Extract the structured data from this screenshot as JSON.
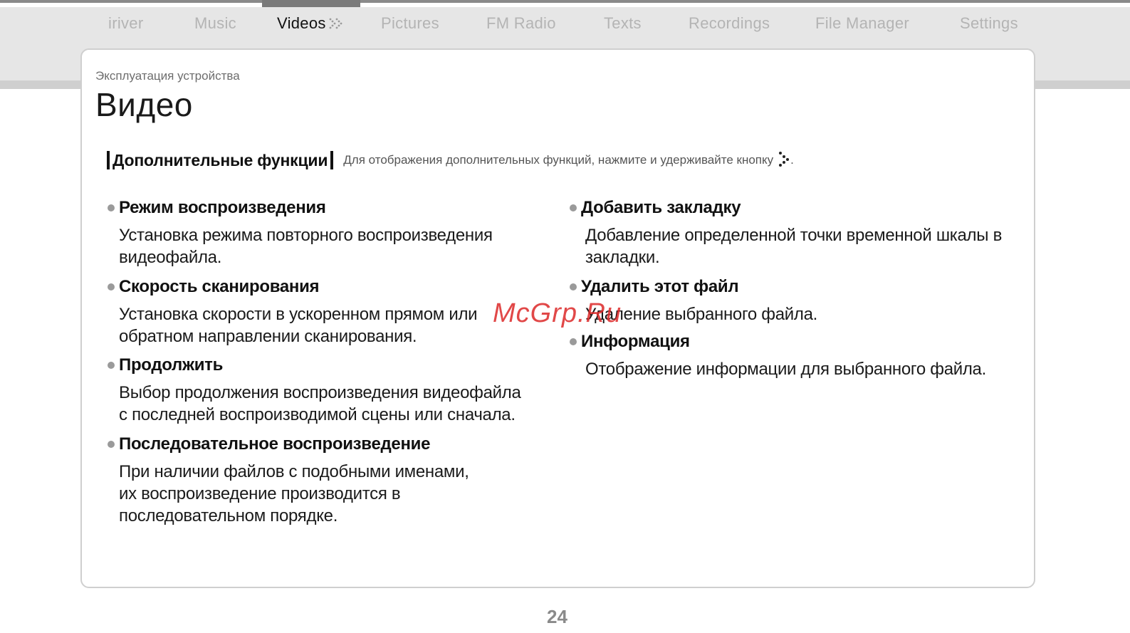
{
  "nav": {
    "items": [
      {
        "label": "iriver"
      },
      {
        "label": "Music"
      },
      {
        "label": "Videos"
      },
      {
        "label": "Pictures"
      },
      {
        "label": "FM Radio"
      },
      {
        "label": "Texts"
      },
      {
        "label": "Recordings"
      },
      {
        "label": "File Manager"
      },
      {
        "label": "Settings"
      }
    ],
    "active": "Videos"
  },
  "breadcrumb": "Эксплуатация устройства",
  "page_title": "Видео",
  "section": {
    "title": "Дополнительные функции",
    "note": "Для отображения дополнительных функций, нажмите и удерживайте кнопку",
    "note_end": "."
  },
  "left_items": [
    {
      "title": "Режим воспроизведения",
      "lines": [
        "Установка режима повторного воспроизведения",
        "видеофайла."
      ]
    },
    {
      "title": "Скорость сканирования",
      "lines": [
        "Установка скорости в ускоренном прямом или",
        "обратном направлении сканирования."
      ]
    },
    {
      "title": "Продолжить",
      "lines": [
        "Выбор продолжения воспроизведения видеофайла",
        "с последней воспроизводимой сцены или сначала."
      ]
    },
    {
      "title": "Последовательное воспроизведение",
      "lines": [
        "При наличии файлов с подобными именами,",
        "их воспроизведение производится в",
        "последовательном порядке."
      ]
    }
  ],
  "right_items": [
    {
      "title": "Добавить закладку",
      "lines": [
        "Добавление определенной точки временной шкалы в",
        "закладки."
      ]
    },
    {
      "title": "Удалить этот файл",
      "lines": [
        "Удаление выбранного файла."
      ]
    },
    {
      "title": "Информация",
      "lines": [
        "Отображение информации для выбранного файла."
      ]
    }
  ],
  "watermark": "McGrp.Ru",
  "page_number": "24",
  "colors": {
    "nav_inactive": "#b4b4b4",
    "nav_active": "#111111",
    "header_band": "#e6e6e6",
    "watermark": "#dc2828",
    "bullet": "#9a9a9a"
  }
}
